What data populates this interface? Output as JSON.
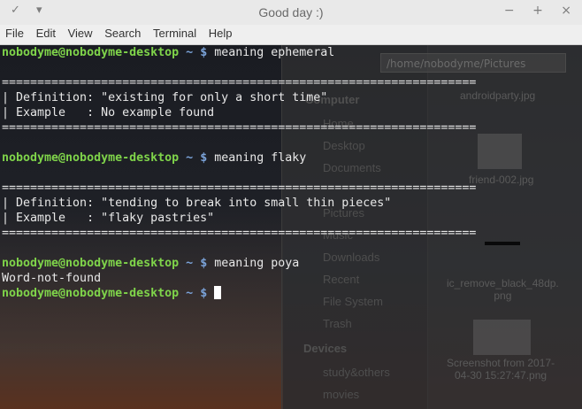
{
  "window": {
    "title": "Good day :)",
    "titlebar_left_icons": [
      "pin-icon",
      "chevron-down-icon"
    ],
    "titlebar_right_icons": [
      "minimize-icon",
      "maximize-icon",
      "close-icon"
    ],
    "titlebar_left_glyphs": [
      "✓",
      "▾"
    ],
    "titlebar_right_glyphs": [
      "−",
      "+",
      "×"
    ]
  },
  "menubar": {
    "items": [
      "File",
      "Edit",
      "View",
      "Search",
      "Terminal",
      "Help"
    ]
  },
  "background_file_manager": {
    "path": "/home/nobodyme/Pictures",
    "places_header": "Computer",
    "places": [
      "Home",
      "Desktop",
      "Documents",
      "Pictures",
      "Music",
      "Downloads",
      "Recent",
      "File System",
      "Trash"
    ],
    "devices_header": "Devices",
    "devices": [
      "study&others",
      "movies"
    ],
    "files": [
      {
        "name": "androidparty.jpg"
      },
      {
        "name": "friend-002.jpg"
      },
      {
        "name": "ic_remove_black_48dp.\npng"
      },
      {
        "name": "Screenshot from 2017-\n04-30 15:27:47.png"
      }
    ]
  },
  "terminal": {
    "user_host": "nobodyme@nobodyme-desktop",
    "path": "~",
    "prompt_symbol": "$",
    "separator": "===================================================================",
    "sessions": [
      {
        "command": "meaning ephemeral",
        "definition_line": "| Definition: \"existing for only a short time\"",
        "example_line": "| Example   : No example found"
      },
      {
        "command": "meaning flaky",
        "definition_line": "| Definition: \"tending to break into small thin pieces\"",
        "example_line": "| Example   : \"flaky pastries\""
      }
    ],
    "third_command": "meaning poya",
    "third_output": "Word-not-found",
    "colors": {
      "user": "#7fd44a",
      "path": "#7aa2d8",
      "text": "#e8e8e8",
      "background": "#1b1b1b"
    }
  }
}
